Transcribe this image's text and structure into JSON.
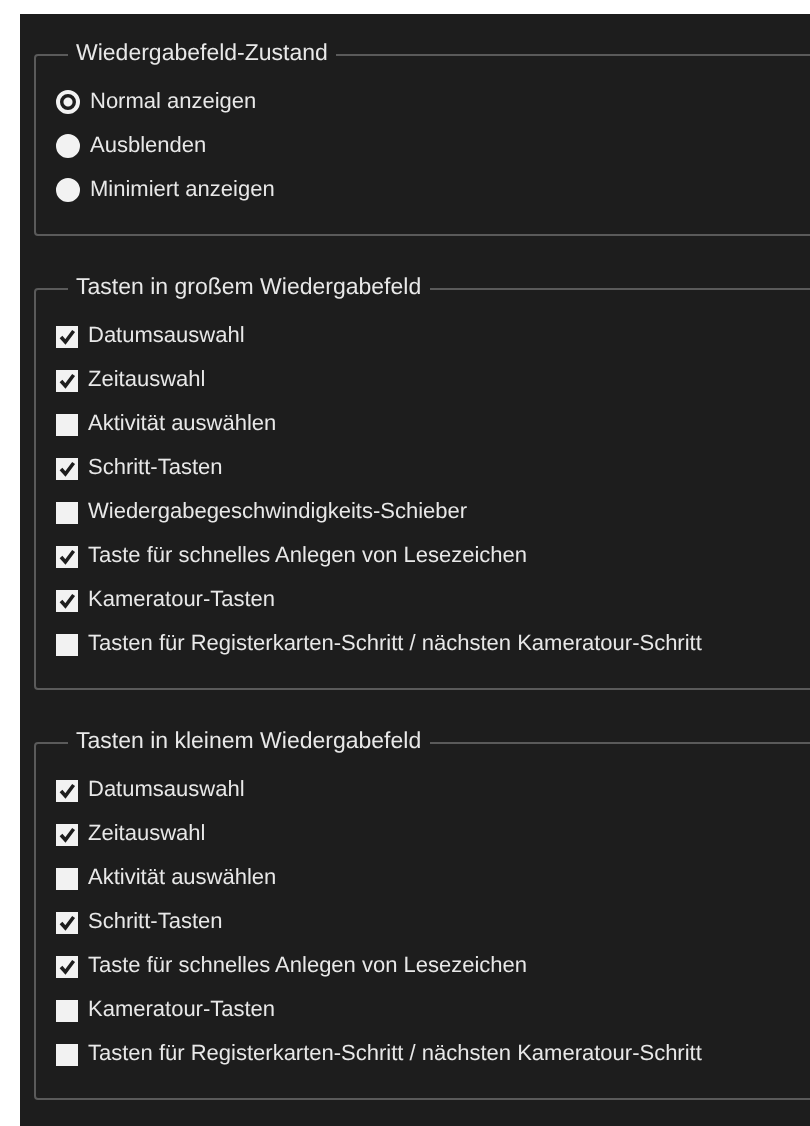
{
  "playback_state": {
    "title": "Wiedergabefeld-Zustand",
    "options": [
      {
        "label": "Normal anzeigen",
        "selected": true
      },
      {
        "label": "Ausblenden",
        "selected": false
      },
      {
        "label": "Minimiert anzeigen",
        "selected": false
      }
    ]
  },
  "groups": [
    {
      "title": "Tasten in großem Wiedergabefeld",
      "items": [
        {
          "label": "Datumsauswahl",
          "checked": true
        },
        {
          "label": "Zeitauswahl",
          "checked": true
        },
        {
          "label": "Aktivität auswählen",
          "checked": false
        },
        {
          "label": "Schritt-Tasten",
          "checked": true
        },
        {
          "label": "Wiedergabegeschwindigkeits-Schieber",
          "checked": false
        },
        {
          "label": "Taste für schnelles Anlegen von Lesezeichen",
          "checked": true
        },
        {
          "label": "Kameratour-Tasten",
          "checked": true
        },
        {
          "label": "Tasten für Registerkarten-Schritt / nächsten Kameratour-Schritt",
          "checked": false
        }
      ]
    },
    {
      "title": "Tasten in kleinem Wiedergabefeld",
      "items": [
        {
          "label": "Datumsauswahl",
          "checked": true
        },
        {
          "label": "Zeitauswahl",
          "checked": true
        },
        {
          "label": "Aktivität auswählen",
          "checked": false
        },
        {
          "label": "Schritt-Tasten",
          "checked": true
        },
        {
          "label": "Taste für schnelles Anlegen von Lesezeichen",
          "checked": true
        },
        {
          "label": "Kameratour-Tasten",
          "checked": false
        },
        {
          "label": "Tasten für Registerkarten-Schritt / nächsten Kameratour-Schritt",
          "checked": false
        }
      ]
    }
  ]
}
